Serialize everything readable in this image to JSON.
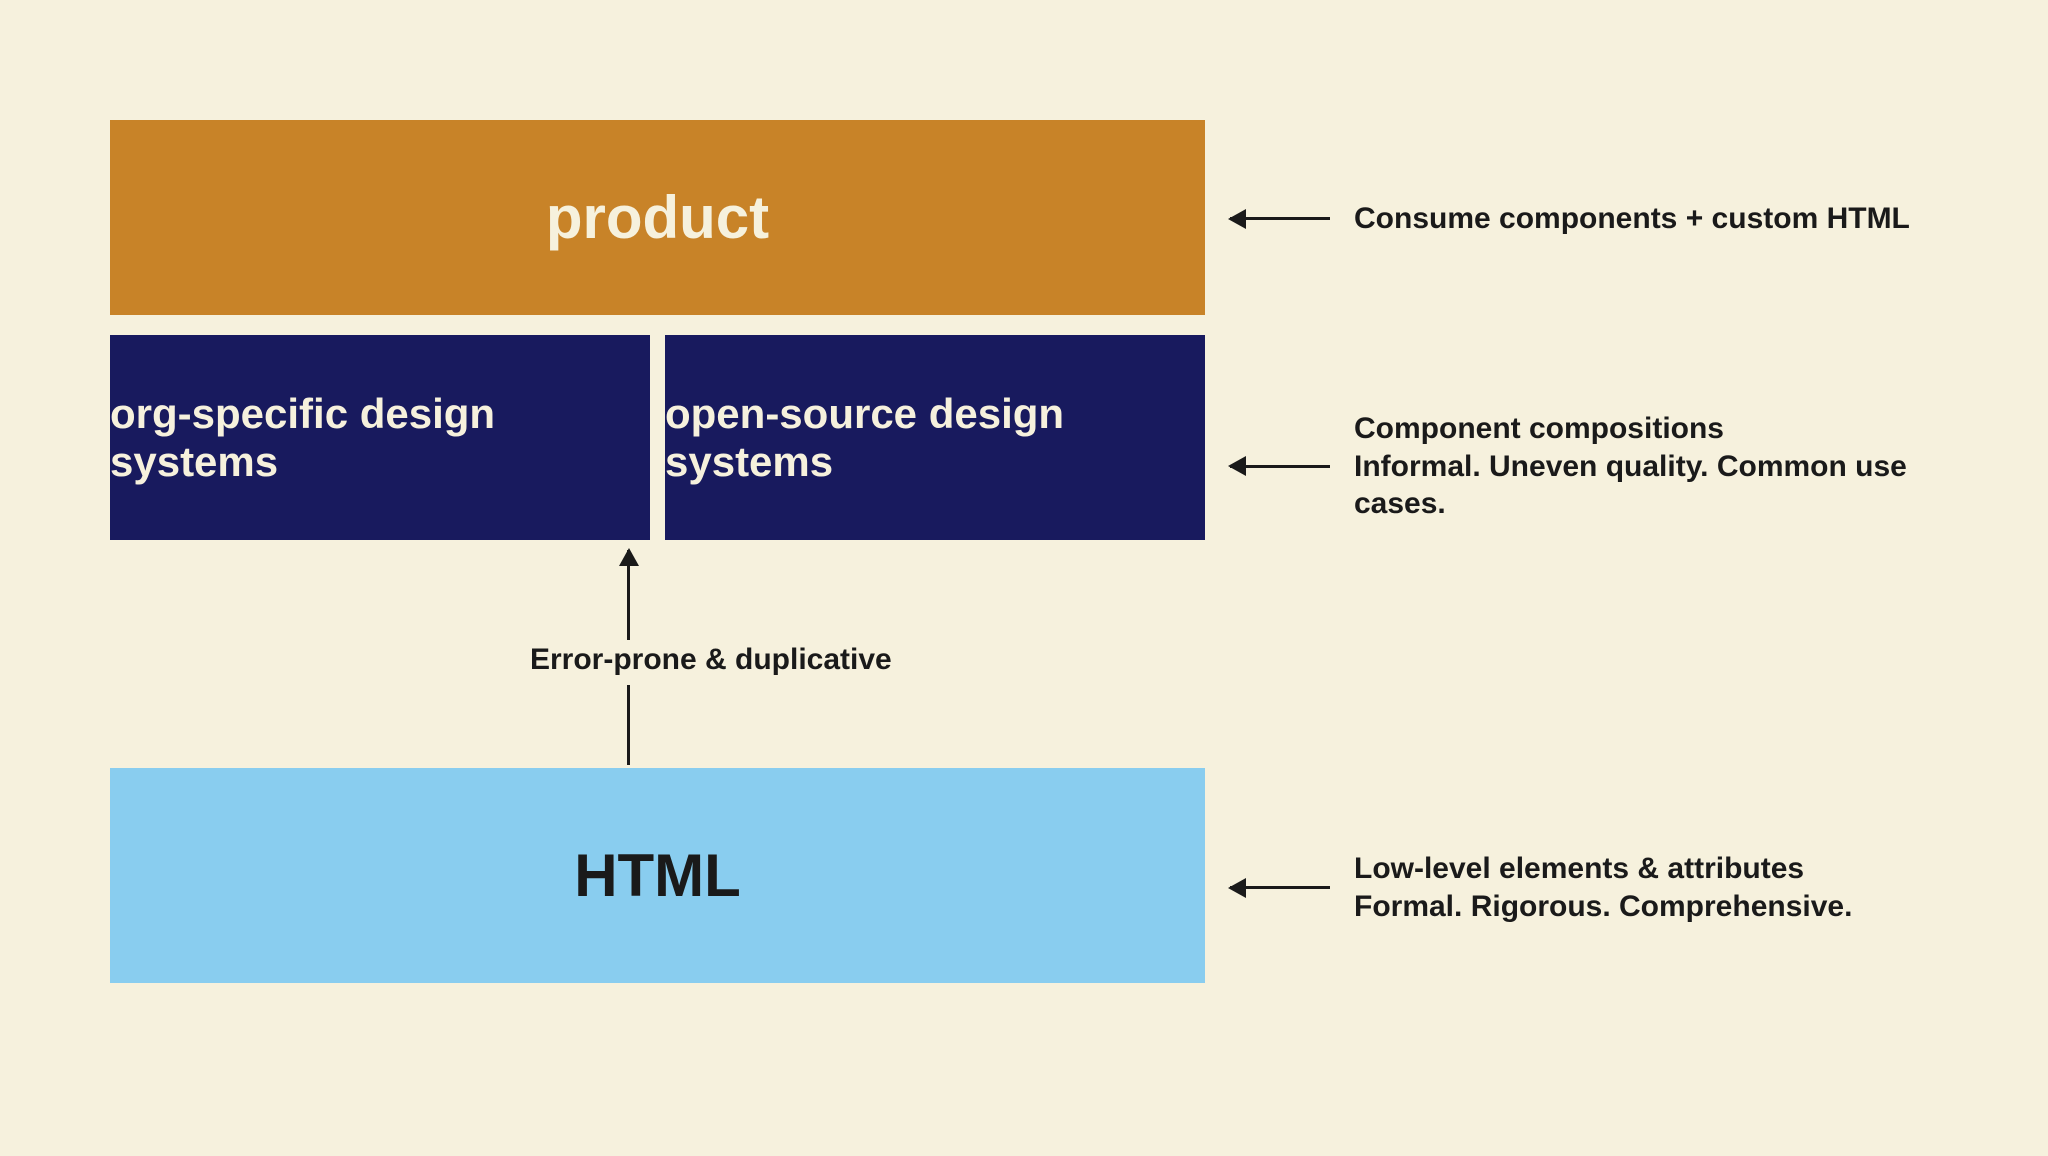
{
  "boxes": {
    "product": "product",
    "org_specific": "org-specific design systems",
    "open_source": "open-source design systems",
    "html": "HTML"
  },
  "annotations": {
    "product": "Consume components + custom HTML",
    "design_systems_line1": "Component compositions",
    "design_systems_line2": "Informal. Uneven quality. Common use cases.",
    "html_line1": "Low-level elements & attributes",
    "html_line2": "Formal. Rigorous. Comprehensive.",
    "vertical": "Error-prone & duplicative"
  },
  "colors": {
    "background": "#f6f1dd",
    "product_bg": "#c88328",
    "ds_bg": "#181a5e",
    "html_bg": "#89cdef",
    "text_dark": "#1a1a1a",
    "text_light": "#f6f1dd"
  }
}
